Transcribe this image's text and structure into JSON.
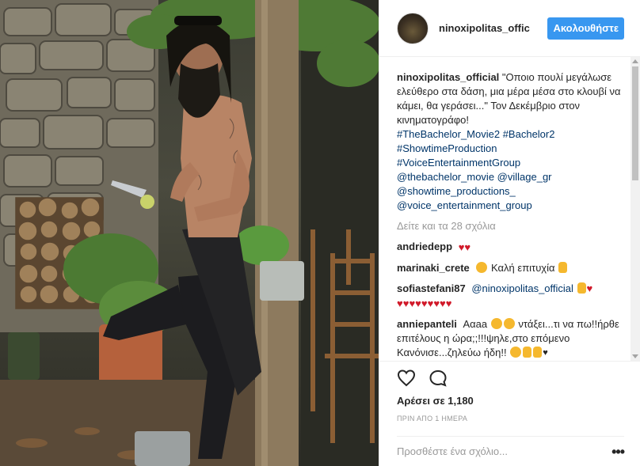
{
  "post": {
    "photo_alt": "",
    "header": {
      "username": "ninoxipolitas_offic",
      "follow_label": "Ακολουθήστε"
    },
    "caption": {
      "username": "ninoxipolitas_official",
      "text": "\"Οποιο πουλί μεγάλωσε ελεύθερο στα δάση, μια μέρα μέσα στο κλουβί να κάμει, θα γεράσει...\" Τον Δεκέμβριο στον κινηματογράφο!",
      "tags": [
        "#TheBachelor_Movie2",
        "#Bachelor2",
        "#ShowtimeProduction",
        "#VoiceEntertainmentGroup"
      ],
      "mentions": [
        "@thebachelor_movie",
        "@village_gr",
        "@showtime_productions_",
        "@voice_entertainment_group"
      ]
    },
    "load_more": "Δείτε και τα 28 σχόλια",
    "comments": [
      {
        "user": "andriedepp",
        "text": ""
      },
      {
        "user": "marinaki_crete",
        "text": "Καλή επιτυχία"
      },
      {
        "user": "sofiastefani87",
        "mention": "@ninoxipolitas_official",
        "text": ""
      },
      {
        "user": "anniepanteli",
        "text_a": "Ααaa",
        "text_b": "ντάξει...τι να πω!!ήρθε επιτέλους η ώρα;;!!!ψηλε,στο επόμενο Κανόνισε...ζηλεύω ήδη!!"
      }
    ],
    "likes": "Αρέσει σε 1,180",
    "time": "ΠΡΙΝ ΑΠΟ 1 ΗΜΕΡΑ",
    "add_comment_placeholder": "Προσθέστε ένα σχόλιο...",
    "more_options": "•••",
    "colors": {
      "accent": "#3897f0",
      "link": "#003569",
      "muted": "#999999",
      "heart": "#d11a2a"
    },
    "icons": [
      "heart-icon",
      "comment-icon",
      "more-options-icon"
    ]
  }
}
